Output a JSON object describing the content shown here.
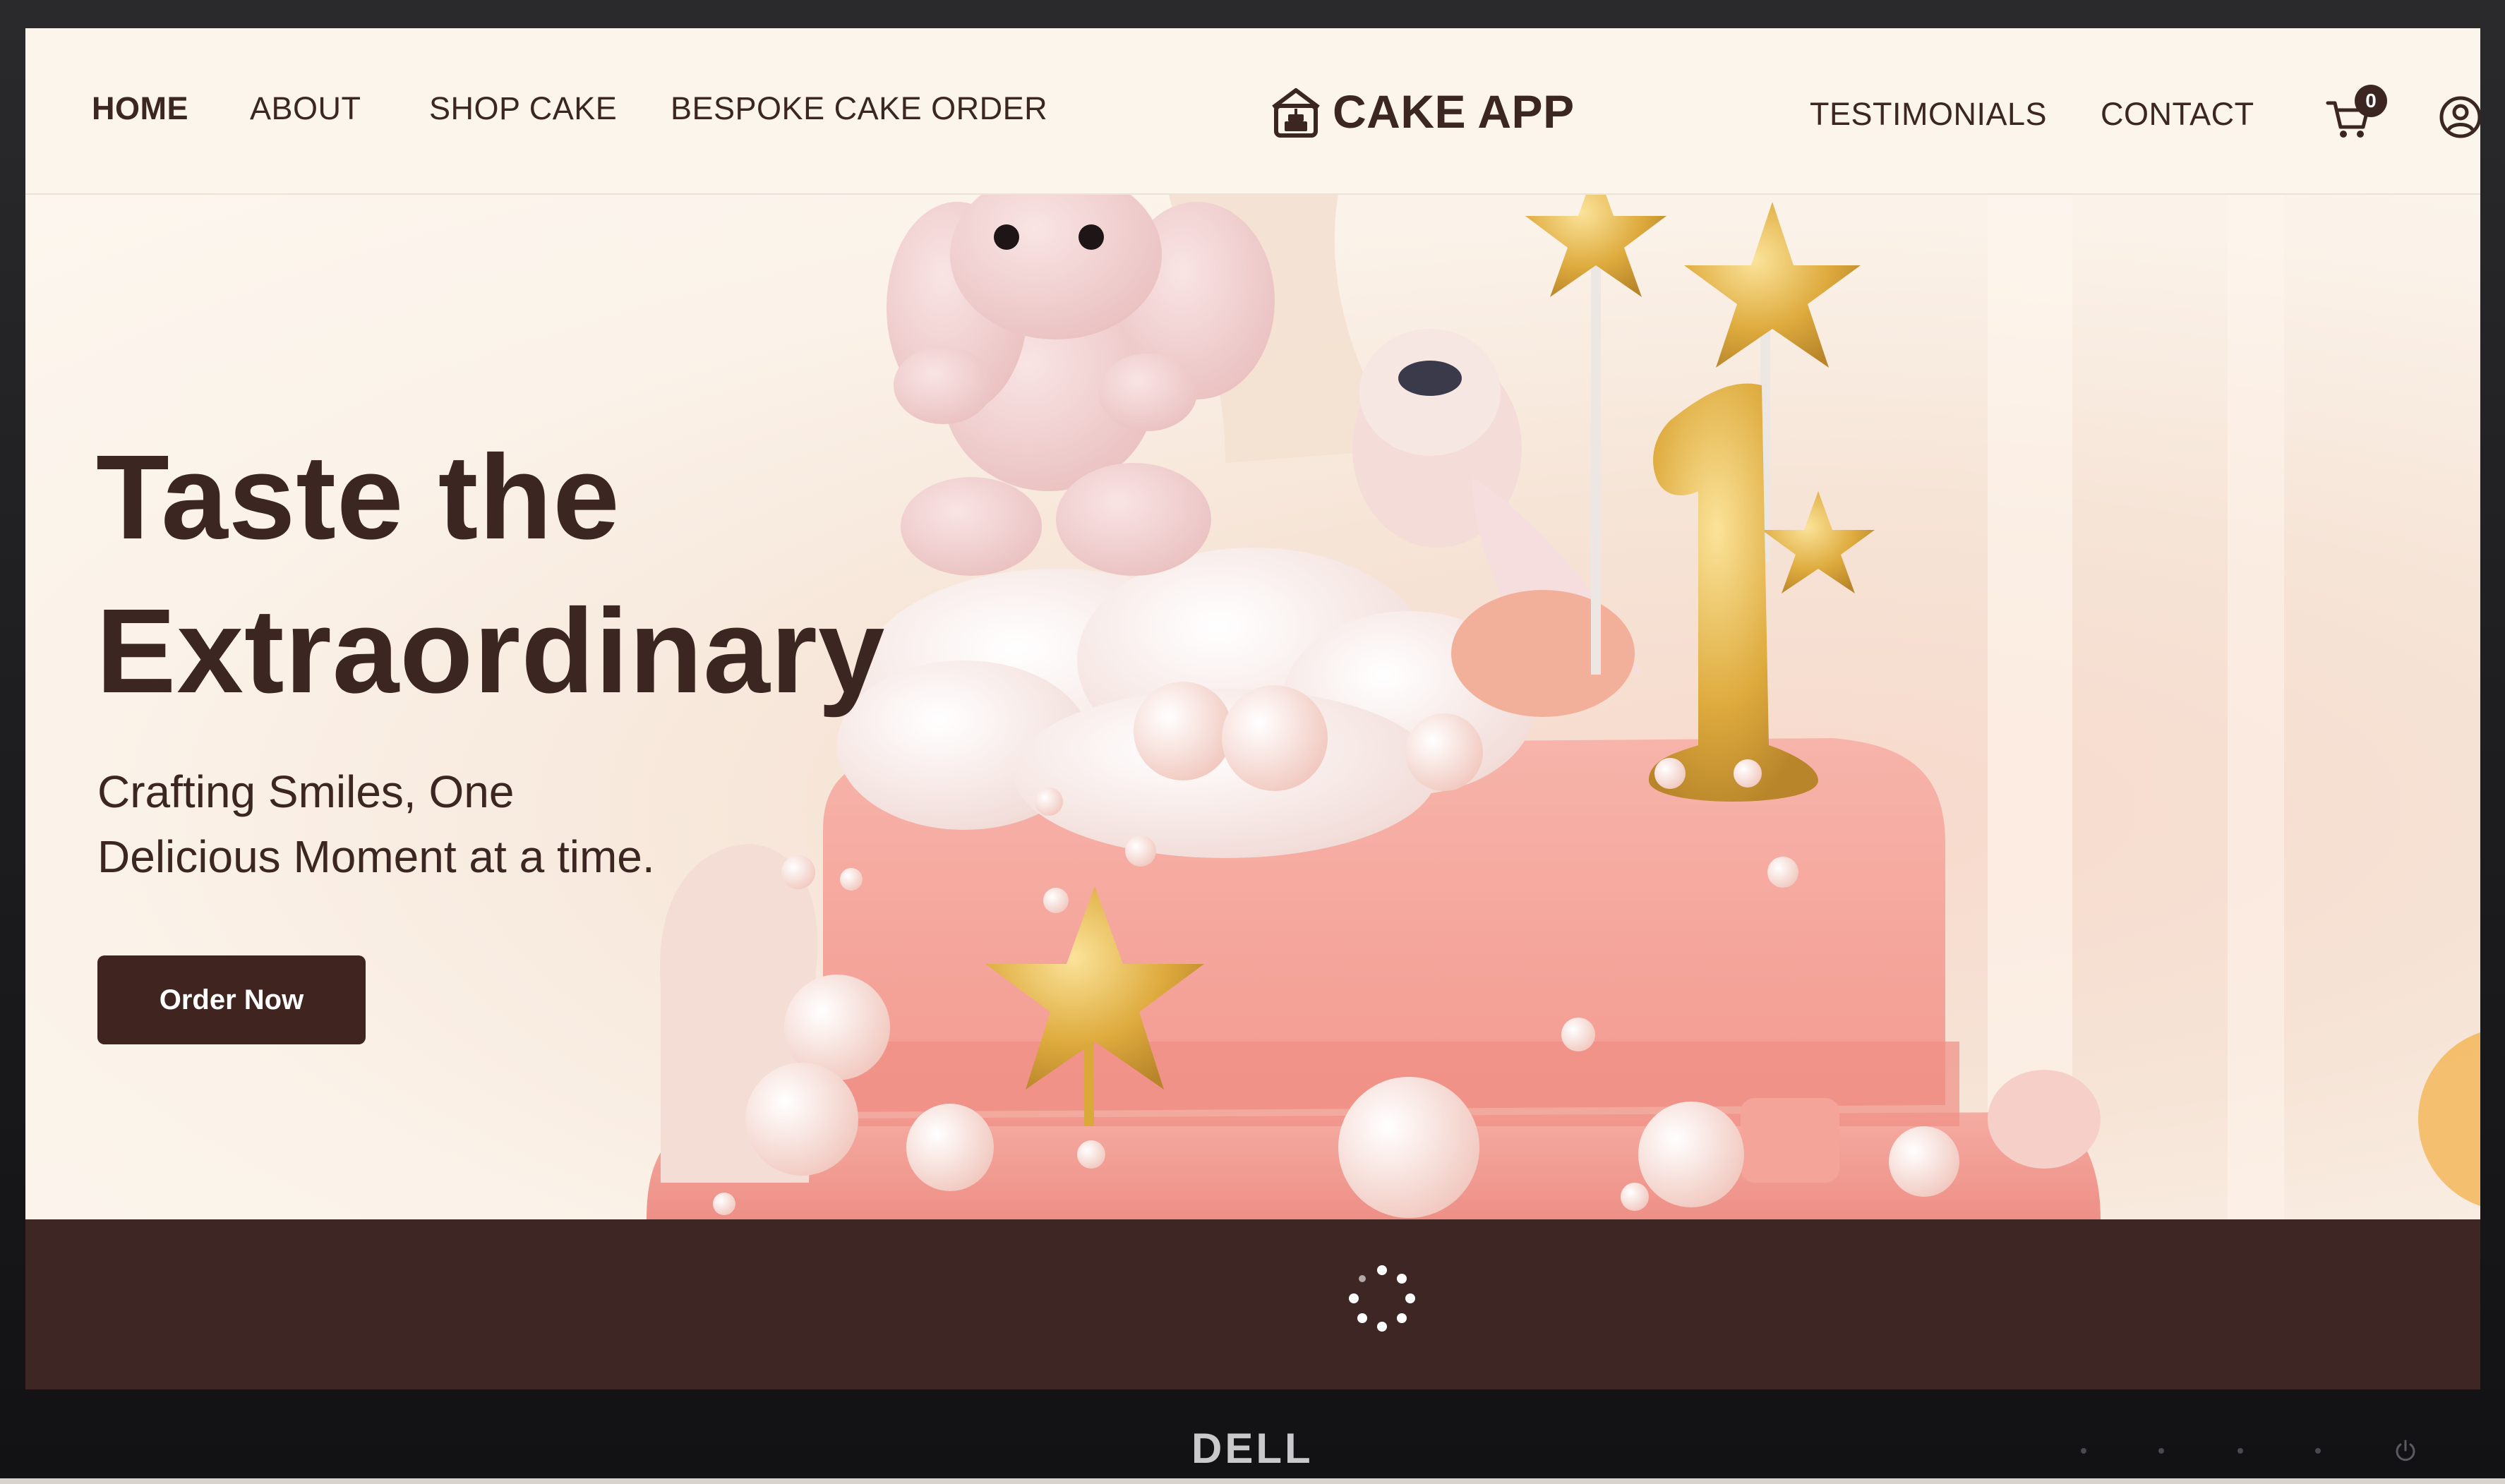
{
  "nav": {
    "items_left": [
      "HOME",
      "ABOUT",
      "SHOP CAKE",
      "BESPOKE CAKE ORDER"
    ],
    "items_right": [
      "TESTIMONIALS",
      "CONTACT"
    ],
    "active": "HOME",
    "logo_text": "CAKE APP",
    "logo_icon": "cake-shop-icon",
    "cart_icon": "cart-icon",
    "cart_count": "0",
    "account_icon": "user-circle-icon"
  },
  "hero": {
    "title_line1": "Taste the",
    "title_line2": "Extraordinary",
    "subtitle_line1": "Crafting Smiles, One",
    "subtitle_line2": "Delicious Moment at a time.",
    "cta_label": "Order Now"
  },
  "loader": {
    "icon": "loading-spinner-icon"
  },
  "monitor": {
    "brand": "DELL",
    "power_icon": "power-icon"
  },
  "colors": {
    "brand_dark": "#3b2622",
    "band": "#3d2623",
    "background": "#fbf5ec",
    "cake_pink": "#f4a49a",
    "gold": "#d9a93a"
  }
}
